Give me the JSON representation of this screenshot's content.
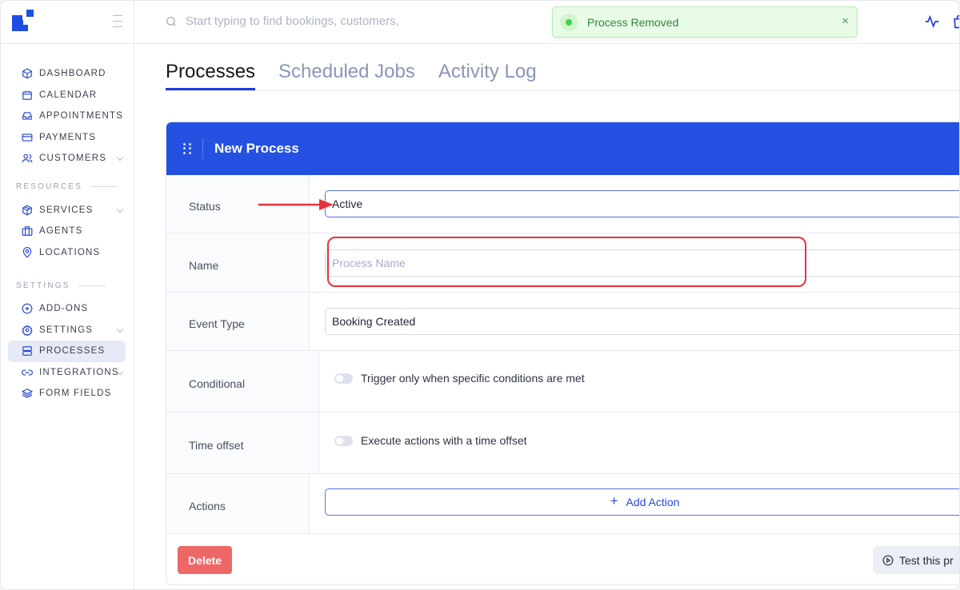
{
  "sidebar": {
    "logo": "app-logo",
    "menu_toggle": "hamburger-icon",
    "items": [
      {
        "label": "DASHBOARD",
        "icon": "cube-icon"
      },
      {
        "label": "CALENDAR",
        "icon": "calendar-icon"
      },
      {
        "label": "APPOINTMENTS",
        "icon": "inbox-icon"
      },
      {
        "label": "PAYMENTS",
        "icon": "credit-card-icon"
      },
      {
        "label": "CUSTOMERS",
        "icon": "users-icon",
        "has_submenu": true
      }
    ],
    "sections": [
      {
        "title": "RESOURCES",
        "items": [
          {
            "label": "SERVICES",
            "icon": "box-icon",
            "has_submenu": true
          },
          {
            "label": "AGENTS",
            "icon": "briefcase-icon"
          },
          {
            "label": "LOCATIONS",
            "icon": "map-pin-icon"
          }
        ]
      },
      {
        "title": "SETTINGS",
        "items": [
          {
            "label": "ADD-ONS",
            "icon": "plus-circle-icon"
          },
          {
            "label": "SETTINGS",
            "icon": "gear-icon",
            "has_submenu": true
          },
          {
            "label": "PROCESSES",
            "icon": "server-icon",
            "active": true
          },
          {
            "label": "INTEGRATIONS",
            "icon": "link-icon",
            "has_submenu": true
          },
          {
            "label": "FORM FIELDS",
            "icon": "layers-icon"
          }
        ]
      }
    ]
  },
  "topbar": {
    "search_placeholder": "Start typing to find bookings, customers,",
    "toast": {
      "message": "Process Removed",
      "close": "×",
      "color": "#3fd14c"
    }
  },
  "tabs": [
    {
      "label": "Processes",
      "active": true
    },
    {
      "label": "Scheduled Jobs",
      "active": false
    },
    {
      "label": "Activity Log",
      "active": false
    }
  ],
  "process_card": {
    "title": "New Process",
    "header_color": "#2451e2",
    "fields": {
      "status": {
        "label": "Status",
        "value": "Active"
      },
      "name": {
        "label": "Name",
        "value": "",
        "placeholder": "Process Name"
      },
      "event_type": {
        "label": "Event Type",
        "value": "Booking Created"
      },
      "conditional": {
        "label": "Conditional",
        "toggle_label": "Trigger only when specific conditions are met",
        "enabled": false
      },
      "time_offset": {
        "label": "Time offset",
        "toggle_label": "Execute actions with a time offset",
        "enabled": false
      },
      "actions": {
        "label": "Actions",
        "button": "Add Action"
      }
    },
    "footer": {
      "delete": "Delete",
      "test": "Test this pr"
    }
  },
  "annotations": {
    "arrow_color": "#e8323f",
    "highlight_color": "#e8323f"
  }
}
